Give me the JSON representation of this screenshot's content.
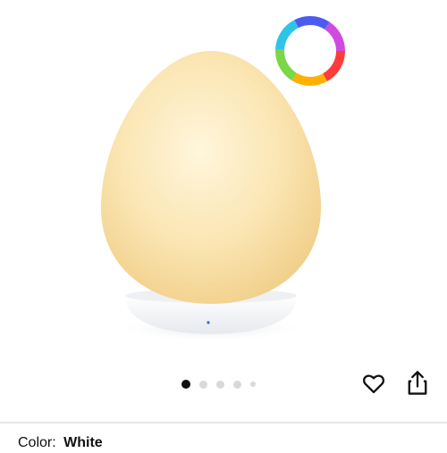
{
  "top_text": "",
  "carousel": {
    "total": 5,
    "active_index": 0
  },
  "actions": {
    "wishlist": "heart-icon",
    "share": "share-icon"
  },
  "product": {
    "color_label": "Color:",
    "color_value": "White"
  },
  "colors": {
    "lamp_glow": "#fbe7b8",
    "base": "#f3f5f8",
    "led": "#2a6cf0",
    "active_dot": "#111111",
    "inactive_dot": "#d9d9d9"
  }
}
